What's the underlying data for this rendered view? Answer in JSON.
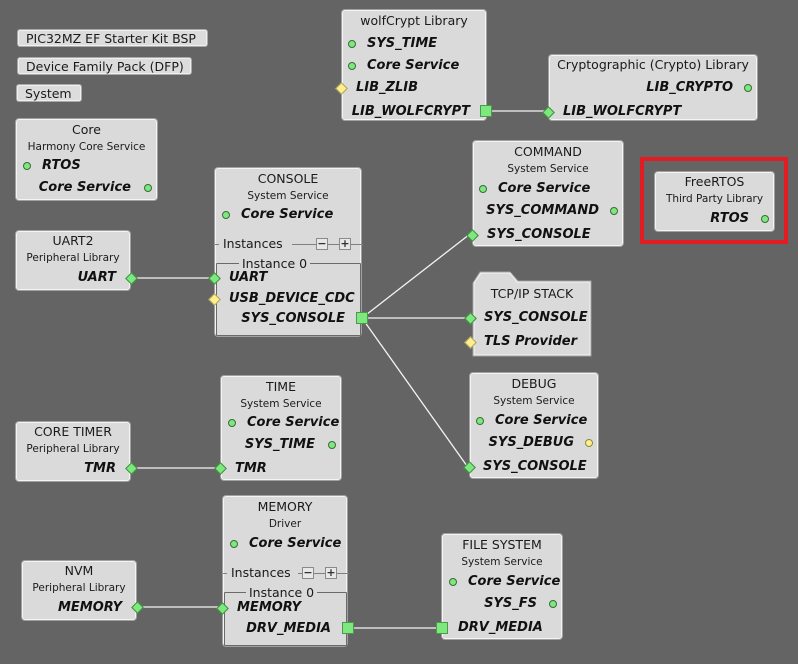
{
  "top_buttons": [
    {
      "label": "PIC32MZ EF Starter Kit BSP"
    },
    {
      "label": "Device Family Pack (DFP)"
    },
    {
      "label": "System"
    }
  ],
  "nodes": {
    "core": {
      "title": "Core",
      "subtitle": "Harmony Core Service",
      "ports": [
        "RTOS",
        "Core Service"
      ]
    },
    "wolfcrypt": {
      "title": "wolfCrypt Library",
      "ports": [
        "SYS_TIME",
        "Core Service",
        "LIB_ZLIB",
        "LIB_WOLFCRYPT"
      ]
    },
    "crypto": {
      "title": "Cryptographic (Crypto) Library",
      "ports": [
        "LIB_CRYPTO",
        "LIB_WOLFCRYPT"
      ]
    },
    "console": {
      "title": "CONSOLE",
      "subtitle": "System Service",
      "ports": [
        "Core Service"
      ],
      "instances_label": "Instances",
      "instance_label": "Instance 0",
      "instance_ports": [
        "UART",
        "USB_DEVICE_CDC",
        "SYS_CONSOLE"
      ],
      "minus": "−",
      "plus": "+"
    },
    "uart2": {
      "title": "UART2",
      "subtitle": "Peripheral Library",
      "ports": [
        "UART"
      ]
    },
    "command": {
      "title": "COMMAND",
      "subtitle": "System Service",
      "ports": [
        "Core Service",
        "SYS_COMMAND",
        "SYS_CONSOLE"
      ]
    },
    "freertos": {
      "title": "FreeRTOS",
      "subtitle": "Third Party Library",
      "ports": [
        "RTOS"
      ],
      "highlighted": true
    },
    "tcpip": {
      "title": "TCP/IP STACK",
      "ports": [
        "SYS_CONSOLE",
        "TLS Provider"
      ]
    },
    "debug": {
      "title": "DEBUG",
      "subtitle": "System Service",
      "ports": [
        "Core Service",
        "SYS_DEBUG",
        "SYS_CONSOLE"
      ]
    },
    "time": {
      "title": "TIME",
      "subtitle": "System Service",
      "ports": [
        "Core Service",
        "SYS_TIME",
        "TMR"
      ]
    },
    "coretimer": {
      "title": "CORE TIMER",
      "subtitle": "Peripheral Library",
      "ports": [
        "TMR"
      ]
    },
    "memory": {
      "title": "MEMORY",
      "subtitle": "Driver",
      "ports": [
        "Core Service"
      ],
      "instances_label": "Instances",
      "instance_label": "Instance 0",
      "instance_ports": [
        "MEMORY",
        "DRV_MEDIA"
      ],
      "minus": "−",
      "plus": "+"
    },
    "nvm": {
      "title": "NVM",
      "subtitle": "Peripheral Library",
      "ports": [
        "MEMORY"
      ]
    },
    "filesystem": {
      "title": "FILE SYSTEM",
      "subtitle": "System Service",
      "ports": [
        "Core Service",
        "SYS_FS",
        "DRV_MEDIA"
      ]
    }
  },
  "connections": [
    {
      "from": "wolfCrypt Library.LIB_WOLFCRYPT",
      "to": "Cryptographic (Crypto) Library.LIB_WOLFCRYPT"
    },
    {
      "from": "UART2.UART",
      "to": "CONSOLE.UART"
    },
    {
      "from": "CONSOLE.SYS_CONSOLE",
      "to": "COMMAND.SYS_CONSOLE"
    },
    {
      "from": "CONSOLE.SYS_CONSOLE",
      "to": "TCP/IP STACK.SYS_CONSOLE"
    },
    {
      "from": "CONSOLE.SYS_CONSOLE",
      "to": "DEBUG.SYS_CONSOLE"
    },
    {
      "from": "CORE TIMER.TMR",
      "to": "TIME.TMR"
    },
    {
      "from": "NVM.MEMORY",
      "to": "MEMORY.MEMORY"
    },
    {
      "from": "MEMORY.DRV_MEDIA",
      "to": "FILE SYSTEM.DRV_MEDIA"
    }
  ],
  "colors": {
    "background": "#646464",
    "highlight": "#e31b23",
    "connected": "#7de87d",
    "optional": "#fff08a"
  }
}
